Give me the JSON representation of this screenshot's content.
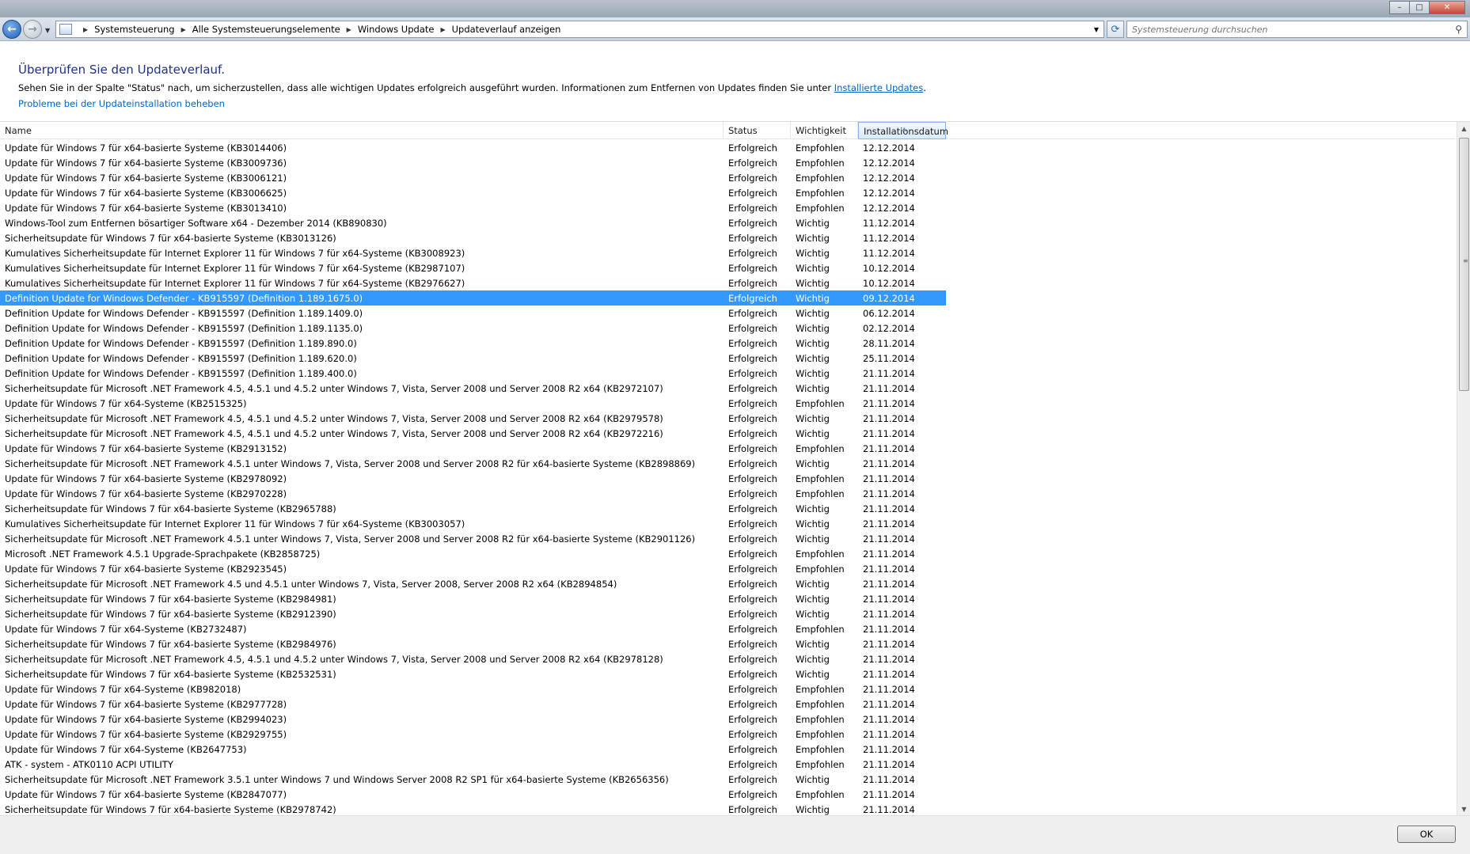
{
  "window": {
    "minimize_glyph": "–",
    "maximize_glyph": "□",
    "close_glyph": "✕"
  },
  "breadcrumb": [
    "Systemsteuerung",
    "Alle Systemsteuerungselemente",
    "Windows Update",
    "Updateverlauf anzeigen"
  ],
  "search": {
    "placeholder": "Systemsteuerung durchsuchen"
  },
  "header": {
    "title": "Überprüfen Sie den Updateverlauf.",
    "description": "Sehen Sie in der Spalte \"Status\" nach, um sicherzustellen, dass alle wichtigen Updates erfolgreich ausgeführt wurden. Informationen zum Entfernen von Updates finden Sie unter ",
    "description_link": "Installierte Updates",
    "description_end": ".",
    "troubleshoot_link": "Probleme bei der Updateinstallation beheben"
  },
  "columns": {
    "name": "Name",
    "status": "Status",
    "importance": "Wichtigkeit",
    "date": "Installationsdatum"
  },
  "selected_index": 10,
  "updates": [
    [
      "Update für Windows 7 für x64-basierte Systeme (KB3014406)",
      "Erfolgreich",
      "Empfohlen",
      "12.12.2014"
    ],
    [
      "Update für Windows 7 für x64-basierte Systeme (KB3009736)",
      "Erfolgreich",
      "Empfohlen",
      "12.12.2014"
    ],
    [
      "Update für Windows 7 für x64-basierte Systeme (KB3006121)",
      "Erfolgreich",
      "Empfohlen",
      "12.12.2014"
    ],
    [
      "Update für Windows 7 für x64-basierte Systeme (KB3006625)",
      "Erfolgreich",
      "Empfohlen",
      "12.12.2014"
    ],
    [
      "Update für Windows 7 für x64-basierte Systeme (KB3013410)",
      "Erfolgreich",
      "Empfohlen",
      "12.12.2014"
    ],
    [
      "Windows-Tool zum Entfernen bösartiger Software x64 - Dezember 2014 (KB890830)",
      "Erfolgreich",
      "Wichtig",
      "11.12.2014"
    ],
    [
      "Sicherheitsupdate für Windows 7 für x64-basierte Systeme (KB3013126)",
      "Erfolgreich",
      "Wichtig",
      "11.12.2014"
    ],
    [
      "Kumulatives Sicherheitsupdate für Internet Explorer 11 für Windows 7 für x64-Systeme (KB3008923)",
      "Erfolgreich",
      "Wichtig",
      "11.12.2014"
    ],
    [
      "Kumulatives Sicherheitsupdate für Internet Explorer 11 für Windows 7 für x64-Systeme (KB2987107)",
      "Erfolgreich",
      "Wichtig",
      "10.12.2014"
    ],
    [
      "Kumulatives Sicherheitsupdate für Internet Explorer 11 für Windows 7 für x64-Systeme (KB2976627)",
      "Erfolgreich",
      "Wichtig",
      "10.12.2014"
    ],
    [
      "Definition Update for Windows Defender - KB915597 (Definition 1.189.1675.0)",
      "Erfolgreich",
      "Wichtig",
      "09.12.2014"
    ],
    [
      "Definition Update for Windows Defender - KB915597 (Definition 1.189.1409.0)",
      "Erfolgreich",
      "Wichtig",
      "06.12.2014"
    ],
    [
      "Definition Update for Windows Defender - KB915597 (Definition 1.189.1135.0)",
      "Erfolgreich",
      "Wichtig",
      "02.12.2014"
    ],
    [
      "Definition Update for Windows Defender - KB915597 (Definition 1.189.890.0)",
      "Erfolgreich",
      "Wichtig",
      "28.11.2014"
    ],
    [
      "Definition Update for Windows Defender - KB915597 (Definition 1.189.620.0)",
      "Erfolgreich",
      "Wichtig",
      "25.11.2014"
    ],
    [
      "Definition Update for Windows Defender - KB915597 (Definition 1.189.400.0)",
      "Erfolgreich",
      "Wichtig",
      "21.11.2014"
    ],
    [
      "Sicherheitsupdate für Microsoft .NET Framework 4.5, 4.5.1 und 4.5.2 unter Windows 7, Vista, Server 2008 und Server 2008 R2 x64 (KB2972107)",
      "Erfolgreich",
      "Wichtig",
      "21.11.2014"
    ],
    [
      "Update für Windows 7 für x64-Systeme (KB2515325)",
      "Erfolgreich",
      "Empfohlen",
      "21.11.2014"
    ],
    [
      "Sicherheitsupdate für Microsoft .NET Framework 4.5, 4.5.1 und 4.5.2 unter Windows 7, Vista, Server 2008 und Server 2008 R2 x64 (KB2979578)",
      "Erfolgreich",
      "Wichtig",
      "21.11.2014"
    ],
    [
      "Sicherheitsupdate für Microsoft .NET Framework 4.5, 4.5.1 und 4.5.2 unter Windows 7, Vista, Server 2008 und Server 2008 R2 x64 (KB2972216)",
      "Erfolgreich",
      "Wichtig",
      "21.11.2014"
    ],
    [
      "Update für Windows 7 für x64-basierte Systeme (KB2913152)",
      "Erfolgreich",
      "Empfohlen",
      "21.11.2014"
    ],
    [
      "Sicherheitsupdate für Microsoft .NET Framework 4.5.1 unter Windows 7, Vista, Server 2008 und Server 2008 R2 für x64-basierte Systeme (KB2898869)",
      "Erfolgreich",
      "Wichtig",
      "21.11.2014"
    ],
    [
      "Update für Windows 7 für x64-basierte Systeme (KB2978092)",
      "Erfolgreich",
      "Empfohlen",
      "21.11.2014"
    ],
    [
      "Update für Windows 7 für x64-basierte Systeme (KB2970228)",
      "Erfolgreich",
      "Empfohlen",
      "21.11.2014"
    ],
    [
      "Sicherheitsupdate für Windows 7 für x64-basierte Systeme (KB2965788)",
      "Erfolgreich",
      "Wichtig",
      "21.11.2014"
    ],
    [
      "Kumulatives Sicherheitsupdate für Internet Explorer 11 für Windows 7 für x64-Systeme (KB3003057)",
      "Erfolgreich",
      "Wichtig",
      "21.11.2014"
    ],
    [
      "Sicherheitsupdate für Microsoft .NET Framework 4.5.1 unter Windows 7, Vista, Server 2008 und Server 2008 R2 für x64-basierte Systeme (KB2901126)",
      "Erfolgreich",
      "Wichtig",
      "21.11.2014"
    ],
    [
      "Microsoft .NET Framework 4.5.1 Upgrade-Sprachpakete (KB2858725)",
      "Erfolgreich",
      "Empfohlen",
      "21.11.2014"
    ],
    [
      "Update für Windows 7 für x64-basierte Systeme (KB2923545)",
      "Erfolgreich",
      "Empfohlen",
      "21.11.2014"
    ],
    [
      "Sicherheitsupdate für Microsoft .NET Framework 4.5 und 4.5.1 unter Windows 7, Vista, Server 2008, Server 2008 R2 x64 (KB2894854)",
      "Erfolgreich",
      "Wichtig",
      "21.11.2014"
    ],
    [
      "Sicherheitsupdate für Windows 7 für x64-basierte Systeme (KB2984981)",
      "Erfolgreich",
      "Wichtig",
      "21.11.2014"
    ],
    [
      "Sicherheitsupdate für Windows 7 für x64-basierte Systeme (KB2912390)",
      "Erfolgreich",
      "Wichtig",
      "21.11.2014"
    ],
    [
      "Update für Windows 7 für x64-Systeme (KB2732487)",
      "Erfolgreich",
      "Empfohlen",
      "21.11.2014"
    ],
    [
      "Sicherheitsupdate für Windows 7 für x64-basierte Systeme (KB2984976)",
      "Erfolgreich",
      "Wichtig",
      "21.11.2014"
    ],
    [
      "Sicherheitsupdate für Microsoft .NET Framework 4.5, 4.5.1 und 4.5.2 unter Windows 7, Vista, Server 2008 und Server 2008 R2 x64 (KB2978128)",
      "Erfolgreich",
      "Wichtig",
      "21.11.2014"
    ],
    [
      "Sicherheitsupdate für Windows 7 für x64-basierte Systeme (KB2532531)",
      "Erfolgreich",
      "Wichtig",
      "21.11.2014"
    ],
    [
      "Update für Windows 7 für x64-Systeme (KB982018)",
      "Erfolgreich",
      "Empfohlen",
      "21.11.2014"
    ],
    [
      "Update für Windows 7 für x64-basierte Systeme (KB2977728)",
      "Erfolgreich",
      "Empfohlen",
      "21.11.2014"
    ],
    [
      "Update für Windows 7 für x64-basierte Systeme (KB2994023)",
      "Erfolgreich",
      "Empfohlen",
      "21.11.2014"
    ],
    [
      "Update für Windows 7 für x64-basierte Systeme (KB2929755)",
      "Erfolgreich",
      "Empfohlen",
      "21.11.2014"
    ],
    [
      "Update für Windows 7 für x64-Systeme (KB2647753)",
      "Erfolgreich",
      "Empfohlen",
      "21.11.2014"
    ],
    [
      "ATK - system - ATK0110 ACPI UTILITY",
      "Erfolgreich",
      "Empfohlen",
      "21.11.2014"
    ],
    [
      "Sicherheitsupdate für Microsoft .NET Framework 3.5.1 unter Windows 7 und Windows Server 2008 R2 SP1 für x64-basierte Systeme (KB2656356)",
      "Erfolgreich",
      "Wichtig",
      "21.11.2014"
    ],
    [
      "Update für Windows 7 für x64-basierte Systeme (KB2847077)",
      "Erfolgreich",
      "Empfohlen",
      "21.11.2014"
    ],
    [
      "Sicherheitsupdate für Windows 7 für x64-basierte Systeme (KB2978742)",
      "Erfolgreich",
      "Wichtig",
      "21.11.2014"
    ]
  ],
  "footer": {
    "ok_label": "OK"
  },
  "colors": {
    "selection": "#3399ff",
    "link": "#0066cc",
    "title": "#1e3287"
  }
}
